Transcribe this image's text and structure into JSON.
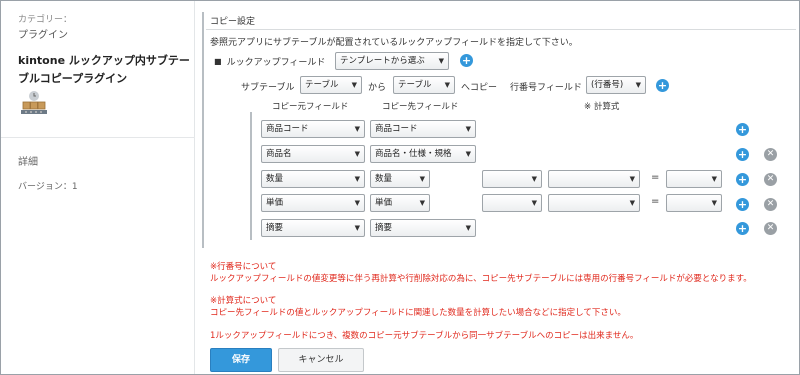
{
  "sidebar": {
    "category_label": "カテゴリー：",
    "category_value": "プラグイン",
    "plugin_title": "kintone ルックアップ内サブテーブルコピープラグイン",
    "icon": "boxes-icon",
    "detail_label": "詳細",
    "version_label": "バージョン：1"
  },
  "section": {
    "title": "コピー設定",
    "description": "参照元アプリにサブテーブルが配置されているルックアップフィールドを指定して下さい。"
  },
  "lookup": {
    "label": "ルックアップフィールド",
    "select_value": "テンプレートから選ぶ"
  },
  "subtable": {
    "label": "サブテーブル",
    "source_select": "テーブル",
    "from_label": "から",
    "dest_select": "テーブル",
    "copy_label": "へコピー",
    "row_field_label": "行番号フィールド",
    "row_field_select": "(行番号)"
  },
  "columns": {
    "source": "コピー元フィールド",
    "dest": "コピー先フィールド",
    "formula": "※ 計算式"
  },
  "rows": [
    {
      "source": "商品コード",
      "dest": "商品コード",
      "formula": false,
      "removable": false
    },
    {
      "source": "商品名",
      "dest": "商品名・仕様・規格",
      "formula": false,
      "removable": true
    },
    {
      "source": "数量",
      "dest": "数量",
      "formula": true,
      "removable": true
    },
    {
      "source": "単価",
      "dest": "単価",
      "formula": true,
      "removable": true
    },
    {
      "source": "摘要",
      "dest": "摘要",
      "formula": false,
      "removable": true
    }
  ],
  "notes": {
    "row_number_title": "※行番号について",
    "row_number_text": "ルックアップフィールドの値変更等に伴う再計算や行削除対応の為に、コピー先サブテーブルには専用の行番号フィールドが必要となります。",
    "formula_title": "※計算式について",
    "formula_text": "コピー先フィールドの値とルックアップフィールドに関連した数量を計算したい場合などに指定して下さい。",
    "limit_text": "1ルックアップフィールドにつき、複数のコピー元サブテーブルから同一サブテーブルへのコピーは出来ません。"
  },
  "buttons": {
    "save": "保存",
    "cancel": "キャンセル"
  },
  "colors": {
    "accent": "#3498db",
    "note_red": "#e0281c"
  }
}
